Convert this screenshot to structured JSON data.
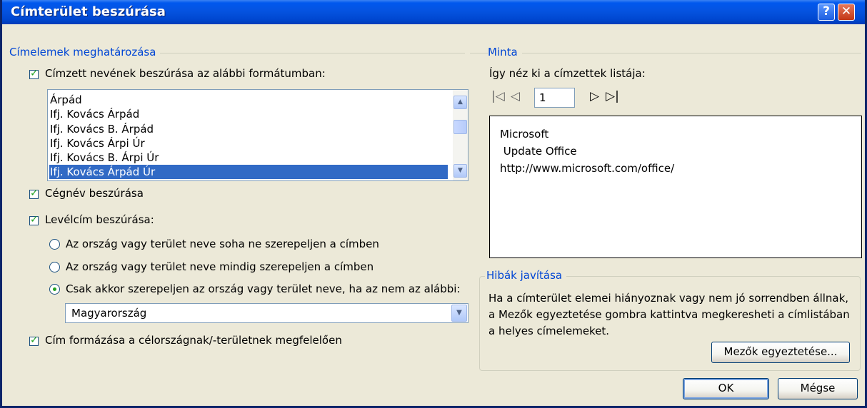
{
  "window": {
    "title": "Címterület beszúrása",
    "help": "?",
    "close": "✕"
  },
  "left": {
    "group_title": "Címelemek meghatározása",
    "insert_name_label": "Címzett nevének beszúrása az alábbi formátumban:",
    "name_formats": [
      "Árpád",
      "Ifj. Kovács Árpád",
      "Ifj. Kovács B. Árpád",
      "Ifj. Kovács Árpi Úr",
      "Ifj. Kovács B. Árpi Úr",
      "Ifj. Kovács Árpád Úr"
    ],
    "insert_company_label": "Cégnév beszúrása",
    "insert_address_label": "Levélcím beszúrása:",
    "radio_never": "Az ország vagy terület neve soha ne szerepeljen a címben",
    "radio_always": "Az ország vagy terület neve mindig szerepeljen a címben",
    "radio_except": "Csak akkor szerepeljen az ország vagy terület neve, ha az nem az alábbi:",
    "country_value": "Magyarország",
    "format_address_label": "Cím formázása a célországnak/-területnek megfelelően"
  },
  "right": {
    "group_title": "Minta",
    "preview_label": "Így néz ki a címzettek listája:",
    "record_number": "1",
    "nav_first": "|◁",
    "nav_prev": "◁",
    "nav_next": "▷",
    "nav_last": "▷|",
    "preview_lines": [
      "Microsoft",
      " Update Office",
      "http://www.microsoft.com/office/"
    ],
    "fix_title": "Hibák javítása",
    "fix_line1": "Ha a címterület elemei hiányoznak vagy nem jó sorrendben állnak,",
    "fix_line2": "a Mezők egyeztetése gombra kattintva megkeresheti a címlistában",
    "fix_line3": "a helyes címelemeket.",
    "match_fields_button": "Mezők egyeztetése...",
    "ok_button": "OK",
    "cancel_button": "Mégse"
  },
  "colors": {
    "titlebar": "#0058EE",
    "group_title": "#0046D5",
    "selection": "#316AC5",
    "dialog_bg": "#ECE9D8"
  }
}
